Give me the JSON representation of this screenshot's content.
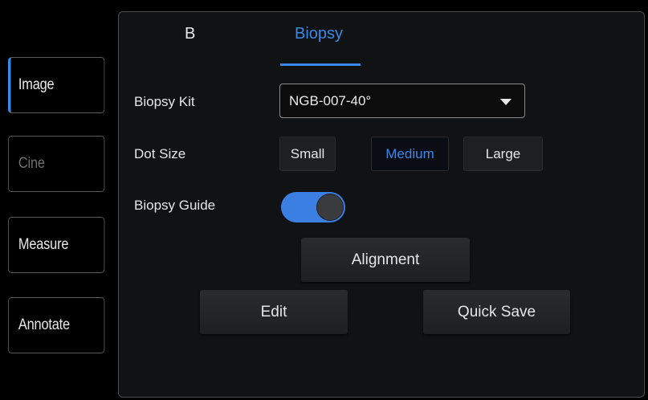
{
  "sidebar": {
    "items": [
      {
        "label": "Image",
        "state": "active"
      },
      {
        "label": "Cine",
        "state": "disabled"
      },
      {
        "label": "Measure",
        "state": "normal"
      },
      {
        "label": "Annotate",
        "state": "normal"
      }
    ]
  },
  "tabs": [
    {
      "label": "B",
      "active": false
    },
    {
      "label": "Biopsy",
      "active": true
    }
  ],
  "biopsy_kit": {
    "label": "Biopsy Kit",
    "value": "NGB-007-40°"
  },
  "dot_size": {
    "label": "Dot Size",
    "options": [
      "Small",
      "Medium",
      "Large"
    ],
    "selected": "Medium"
  },
  "biopsy_guide": {
    "label": "Biopsy Guide",
    "enabled": true
  },
  "buttons": {
    "alignment": "Alignment",
    "edit": "Edit",
    "quick_save": "Quick Save"
  },
  "colors": {
    "accent": "#3b87e6",
    "panel_bg": "#111214",
    "background": "#000000"
  }
}
